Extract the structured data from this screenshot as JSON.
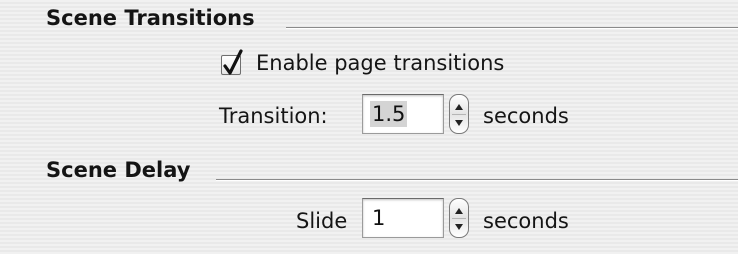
{
  "scene_transitions": {
    "title": "Scene Transitions",
    "enable_label": "Enable page transitions",
    "enable_checked": true,
    "transition_label": "Transition:",
    "transition_value": "1.5",
    "transition_unit": "seconds"
  },
  "scene_delay": {
    "title": "Scene Delay",
    "slide_label": "Slide",
    "slide_value": "1",
    "slide_unit": "seconds"
  },
  "icons": {
    "checkmark": "checkmark-icon",
    "stepper_up": "arrow-up-icon",
    "stepper_down": "arrow-down-icon"
  }
}
